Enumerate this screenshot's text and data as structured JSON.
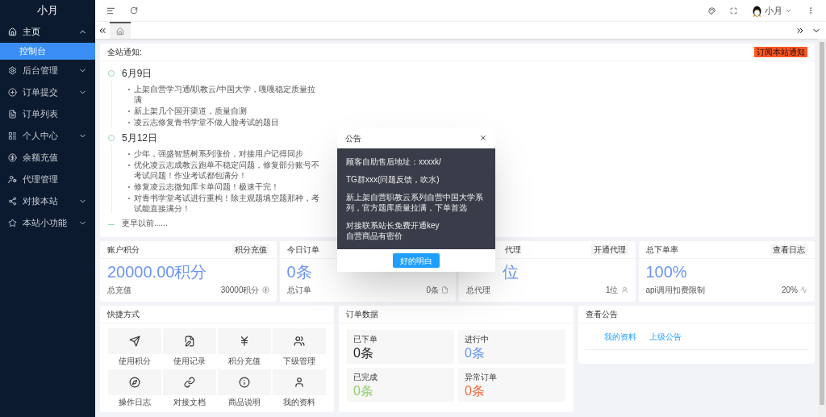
{
  "sidebar": {
    "title": "小月",
    "items": [
      {
        "label": "主页",
        "expanded": true,
        "children": [
          {
            "label": "控制台",
            "selected": true
          }
        ]
      },
      {
        "label": "后台管理",
        "expanded": false
      },
      {
        "label": "订单提交",
        "expanded": false
      },
      {
        "label": "订单列表"
      },
      {
        "label": "个人中心",
        "expanded": false
      },
      {
        "label": "余额充值"
      },
      {
        "label": "代理管理"
      },
      {
        "label": "对接本站",
        "expanded": false
      },
      {
        "label": "本站小功能",
        "expanded": false
      }
    ]
  },
  "header": {
    "user": "小月"
  },
  "notice": {
    "title": "全站通知:",
    "badge": "订阅本站通知",
    "groups": [
      {
        "date": "6月9日",
        "items": [
          "上架自营学习通/职教云/中国大学，嘎嘎稳定质量拉满",
          "新上架几个国开渠道，质量自测",
          "凌云志修复青书学堂不做人脸考试的题目"
        ]
      },
      {
        "date": "5月12日",
        "items": [
          "少年，强盛智慧树系列涨价，对接用户记得同步",
          "优化凌云志成教云跑单不稳定问题，修复部分账号不考试问题！作业考试都包满分！",
          "修复凌云志微知库卡单问题！极速干完！",
          "对青书学堂考试进行重构！除主观题填空题那种，考试能直接满分！"
        ]
      }
    ],
    "more": "更早以前......"
  },
  "stats": [
    {
      "title": "账户积分",
      "button": "积分充值",
      "value": "20000.00积分",
      "footer": "总充值",
      "footer_value": "30000积分",
      "covered": false
    },
    {
      "title": "今日订单",
      "value": "0条",
      "footer": "总订单",
      "footer_value": "0条",
      "covered": false
    },
    {
      "title": "代理",
      "button": "开通代理",
      "value": "位",
      "footer": "总代理",
      "footer_value": "1位",
      "covered": true
    },
    {
      "title": "总下单率",
      "button": "查看日志",
      "value": "100%",
      "footer": "api调用扣费限制",
      "footer_value": "20%",
      "covered": false
    }
  ],
  "shortcuts": {
    "title": "快捷方式",
    "items": [
      "使用积分",
      "使用记录",
      "积分充值",
      "下级管理",
      "操作日志",
      "对接文档",
      "商品说明",
      "我的资料"
    ]
  },
  "orders": {
    "title": "订单数据",
    "tiles": [
      {
        "label": "已下单",
        "value": "0条",
        "color": "#222222"
      },
      {
        "label": "进行中",
        "value": "0条",
        "color": "#6b95f5"
      },
      {
        "label": "已完成",
        "value": "0条",
        "color": "#93cf6a"
      },
      {
        "label": "异常订单",
        "value": "0条",
        "color": "#f06a41"
      }
    ]
  },
  "announcements": {
    "title": "查看公告",
    "links": [
      "我的资料",
      "上级公告"
    ]
  },
  "modal": {
    "title": "公告",
    "paragraphs": [
      "顾客自助售后地址：xxxxk/",
      "TG群xxx(问题反馈，吹水)",
      "新上架自营职教云系列自营中国大学系列，官方题库质量拉满，下单首选",
      "对接联系站长免费开通key\n自营商品有密价"
    ],
    "button": "好的明白"
  }
}
